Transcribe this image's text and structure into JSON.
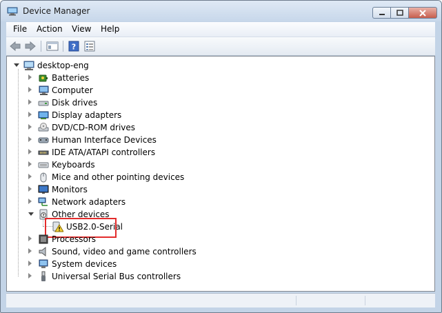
{
  "window": {
    "title": "Device Manager",
    "icons": {
      "app": "device-manager-icon",
      "minimize": "minimize-icon",
      "maximize": "maximize-icon",
      "close": "close-icon"
    },
    "colors": {
      "frame": "#c3d4e7",
      "highlight_box": "#e32b2b",
      "close_button": "#c75e4d"
    }
  },
  "menu": {
    "file": "File",
    "action": "Action",
    "view": "View",
    "help": "Help"
  },
  "toolbar": {
    "icons": [
      "back-arrow-icon",
      "forward-arrow-icon",
      "show-hide-console-tree-icon",
      "help-icon",
      "properties-icon"
    ]
  },
  "tree": {
    "root": {
      "label": "desktop-eng",
      "icon": "computer-icon",
      "expanded": true
    },
    "items": [
      {
        "label": "Batteries",
        "icon": "battery-icon"
      },
      {
        "label": "Computer",
        "icon": "computer-icon"
      },
      {
        "label": "Disk drives",
        "icon": "disk-drive-icon"
      },
      {
        "label": "Display adapters",
        "icon": "display-adapter-icon"
      },
      {
        "label": "DVD/CD-ROM drives",
        "icon": "dvd-drive-icon"
      },
      {
        "label": "Human Interface Devices",
        "icon": "hid-icon"
      },
      {
        "label": "IDE ATA/ATAPI controllers",
        "icon": "ide-controller-icon"
      },
      {
        "label": "Keyboards",
        "icon": "keyboard-icon"
      },
      {
        "label": "Mice and other pointing devices",
        "icon": "mouse-icon"
      },
      {
        "label": "Monitors",
        "icon": "monitor-icon"
      },
      {
        "label": "Network adapters",
        "icon": "network-adapter-icon"
      },
      {
        "label": "Other devices",
        "icon": "unknown-device-icon",
        "expanded": true
      },
      {
        "label": "Processors",
        "icon": "processor-icon"
      },
      {
        "label": "Sound, video and game controllers",
        "icon": "speaker-icon"
      },
      {
        "label": "System devices",
        "icon": "system-devices-icon"
      },
      {
        "label": "Universal Serial Bus controllers",
        "icon": "usb-icon"
      }
    ],
    "child": {
      "parent": "Other devices",
      "label": "USB2.0-Serial",
      "icon": "warning-device-icon",
      "highlighted": true
    }
  }
}
